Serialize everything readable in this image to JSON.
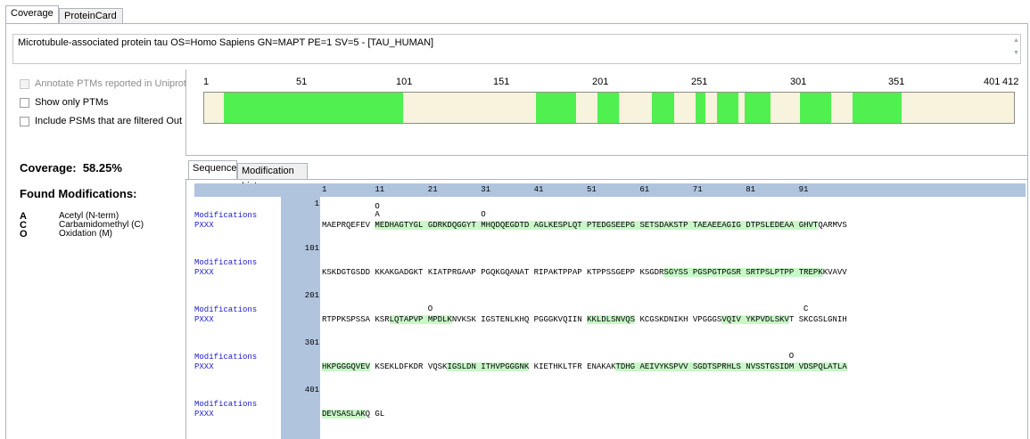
{
  "tabs": [
    {
      "label": "Coverage",
      "active": true
    },
    {
      "label": "ProteinCard",
      "active": false
    }
  ],
  "protein_description": "Microtubule-associated protein tau OS=Homo Sapiens GN=MAPT PE=1 SV=5 - [TAU_HUMAN]",
  "options": {
    "annotate_ptms": {
      "label": "Annotate PTMs reported in Uniprot",
      "checked": false,
      "enabled": false
    },
    "show_only_ptms": {
      "label": "Show only PTMs",
      "checked": false
    },
    "include_filtered": {
      "label": "Include PSMs that are filtered Out",
      "checked": false
    }
  },
  "coverage": {
    "label": "Coverage:",
    "value": "58.25%"
  },
  "found_modifications": {
    "title": "Found Modifications:",
    "items": [
      {
        "code": "A",
        "name": "Acetyl (N-term)"
      },
      {
        "code": "C",
        "name": "Carbamidomethyl (C)"
      },
      {
        "code": "O",
        "name": "Oxidation (M)"
      }
    ]
  },
  "coverage_map": {
    "ticks": [
      "1",
      "51",
      "101",
      "151",
      "201",
      "251",
      "301",
      "351",
      "401",
      "412"
    ],
    "segments": [
      [
        11,
        101
      ],
      [
        170,
        189
      ],
      [
        201,
        211
      ],
      [
        229,
        239
      ],
      [
        251,
        255
      ],
      [
        262,
        272
      ],
      [
        276,
        288
      ],
      [
        304,
        319
      ],
      [
        331,
        355
      ]
    ],
    "colors": {
      "covered": "#50f050",
      "uncovered": "#f7f3dc"
    }
  },
  "inner_tabs": [
    {
      "label": "Sequence",
      "active": true
    },
    {
      "label": "Modification List",
      "active": false
    }
  ],
  "sequence": {
    "column_numbers": [
      "1",
      "11",
      "21",
      "31",
      "41",
      "51",
      "61",
      "71",
      "81",
      "91"
    ],
    "row_labels": {
      "modifications": "Modifications",
      "pxxx": "PXXX"
    },
    "blocks": [
      {
        "start": "1",
        "text": "MAEPRQEFEV MEDHAGTYGL GDRKDQGGYT MHQDQEGDTD AGLKESPLQT PTEDGSEEPG SETSDAKSTP TAEAEEAGIG DTPSLEDEAA GHVTQARMVS",
        "covered": [
          [
            11,
            94
          ]
        ]
      },
      {
        "start": "101",
        "text": "KSKDGTGSDD KKAKGADGKT KIATPRGAAP PGQKGQANAT RIPAKTPPAP KTPPSSGEPP KSGDRSGYSS PGSPGTPGSR SRTPSLPTPP TREPKKVAVV",
        "covered": [
          [
            66,
            95
          ]
        ]
      },
      {
        "start": "201",
        "text": "RTPPKSPSSA KSRLQTAPVP MPDLKNVKSK IGSTENLKHQ PGGGKVQIIN KKLDLSNVQS KCGSKDNIKH VPGGGSVQIV YKPVDLSKVT SKCGSLGNIH",
        "covered": [
          [
            14,
            25
          ],
          [
            51,
            60
          ],
          [
            77,
            89
          ]
        ]
      },
      {
        "start": "301",
        "text": "HKPGGGQVEV KSEKLDFKDR VQSKIGSLDN ITHVPGGGNK KIETHKLTFR ENAKAKTDHG AEIVYKSPVV SGDTSPRHLS NVSSTGSIDM VDSPQLATLA",
        "covered": [
          [
            1,
            10
          ],
          [
            25,
            40
          ],
          [
            57,
            100
          ]
        ]
      },
      {
        "start": "401",
        "text": "DEVSASLAKQ GL",
        "covered": [
          [
            1,
            9
          ]
        ]
      }
    ],
    "mods": [
      {
        "block": 0,
        "pos": 11,
        "symbols": [
          "O",
          "A"
        ]
      },
      {
        "block": 0,
        "pos": 31,
        "symbols": [
          "O"
        ]
      },
      {
        "block": 2,
        "pos": 21,
        "symbols": [
          "O"
        ]
      },
      {
        "block": 2,
        "pos": 92,
        "symbols": [
          "C"
        ]
      },
      {
        "block": 3,
        "pos": 90,
        "symbols": [
          "O"
        ]
      }
    ]
  }
}
